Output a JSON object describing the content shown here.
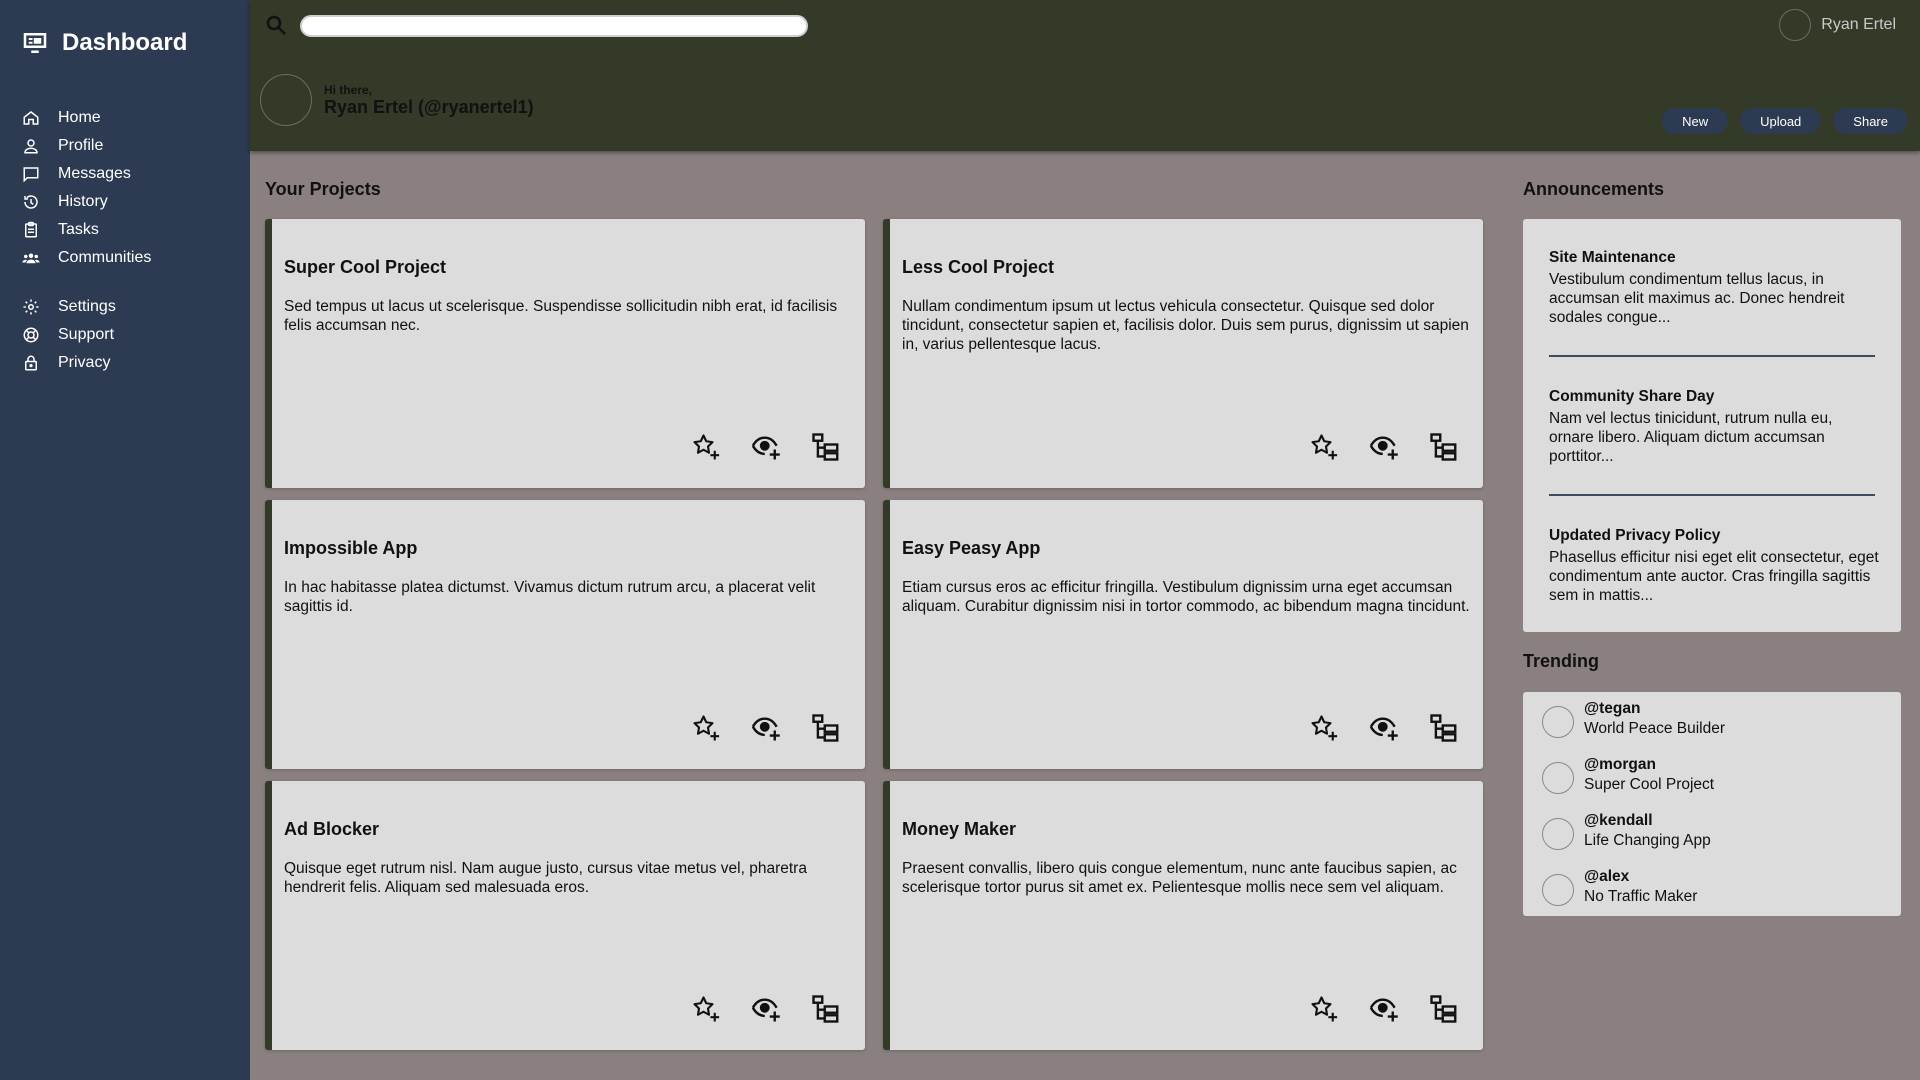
{
  "sidebar": {
    "brand": "Dashboard",
    "brand_icon": "monitor-icon",
    "items": [
      {
        "label": "Home",
        "icon": "home-icon"
      },
      {
        "label": "Profile",
        "icon": "user-icon"
      },
      {
        "label": "Messages",
        "icon": "message-icon"
      },
      {
        "label": "History",
        "icon": "history-icon"
      },
      {
        "label": "Tasks",
        "icon": "clipboard-icon"
      },
      {
        "label": "Communities",
        "icon": "group-icon"
      },
      {
        "label": "Settings",
        "icon": "gear-icon"
      },
      {
        "label": "Support",
        "icon": "support-icon"
      },
      {
        "label": "Privacy",
        "icon": "lock-icon"
      }
    ]
  },
  "header": {
    "search_placeholder": "",
    "user_name": "Ryan Ertel",
    "greeting": "Hi there,",
    "full_name": "Ryan Ertel (@ryanertel1)",
    "actions": [
      "New",
      "Upload",
      "Share"
    ]
  },
  "projects": {
    "title": "Your Projects",
    "items": [
      {
        "title": "Super Cool Project",
        "desc": "Sed tempus ut lacus ut scelerisque. Suspendisse sollicitudin nibh erat, id facilisis felis accumsan nec."
      },
      {
        "title": "Less Cool Project",
        "desc": "Nullam condimentum ipsum ut lectus vehicula consectetur. Quisque sed dolor tincidunt, consectetur sapien et, facilisis dolor. Duis sem purus, dignissim ut sapien in, varius pellentesque lacus."
      },
      {
        "title": "Impossible App",
        "desc": "In hac habitasse platea dictumst. Vivamus dictum rutrum arcu, a placerat velit sagittis id."
      },
      {
        "title": "Easy Peasy App",
        "desc": "Etiam cursus eros ac efficitur fringilla. Vestibulum dignissim urna eget accumsan aliquam. Curabitur dignissim nisi in tortor commodo, ac bibendum magna tincidunt."
      },
      {
        "title": "Ad Blocker",
        "desc": "Quisque eget rutrum nisl. Nam augue justo, cursus vitae metus vel, pharetra hendrerit felis. Aliquam sed malesuada eros."
      },
      {
        "title": "Money Maker",
        "desc": "Praesent convallis, libero quis congue elementum, nunc ante faucibus sapien, ac scelerisque tortor purus sit amet ex. Pelientesque mollis nece sem vel aliquam."
      }
    ],
    "card_icons": [
      "star-add-icon",
      "watch-add-icon",
      "fork-icon"
    ]
  },
  "announcements": {
    "title": "Announcements",
    "items": [
      {
        "title": "Site Maintenance",
        "body": "Vestibulum condimentum tellus lacus, in accumsan elit maximus ac. Donec hendreit sodales congue..."
      },
      {
        "title": "Community Share Day",
        "body": "Nam vel lectus tinicidunt, rutrum nulla eu, ornare libero. Aliquam dictum accumsan porttitor..."
      },
      {
        "title": "Updated Privacy Policy",
        "body": "Phasellus efficitur nisi eget elit consectetur, eget condimentum ante auctor. Cras fringilla sagittis sem in mattis..."
      }
    ]
  },
  "trending": {
    "title": "Trending",
    "items": [
      {
        "handle": "@tegan",
        "project": "World Peace Builder"
      },
      {
        "handle": "@morgan",
        "project": "Super Cool Project"
      },
      {
        "handle": "@kendall",
        "project": "Life Changing App"
      },
      {
        "handle": "@alex",
        "project": "No Traffic Maker"
      }
    ]
  },
  "colors": {
    "sidebar_bg": "#2c3a52",
    "header_bg": "#333a27",
    "page_bg": "#8a8080",
    "card_bg": "#dcdcdc"
  }
}
